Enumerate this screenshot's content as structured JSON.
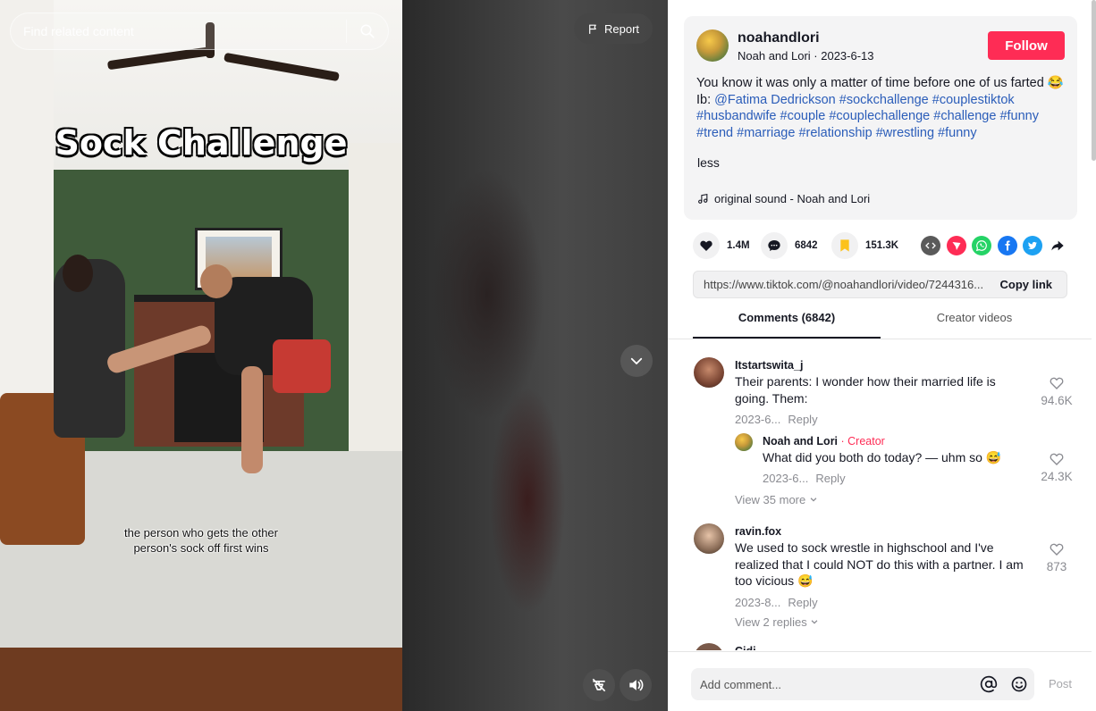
{
  "search": {
    "placeholder": "Find related content"
  },
  "video": {
    "overlay_title": "Sock Challenge",
    "overlay_caption": "the person who gets the other person's sock off first wins",
    "report_label": "Report"
  },
  "post": {
    "username": "noahandlori",
    "display_name": "Noah and Lori",
    "date": "2023-6-13",
    "follow_label": "Follow",
    "desc_intro": "You know it was only a matter of time before one of us farted 😂 Ib: ",
    "tags": [
      "@Fatima Dedrickson",
      "#sockchallenge",
      "#couplestiktok",
      "#husbandwife",
      "#couple",
      "#couplechallenge",
      "#challenge",
      "#funny",
      "#trend",
      "#marriage",
      "#relationship",
      "#wrestling",
      "#funny"
    ],
    "less_label": "less",
    "music": "original sound - Noah and Lori"
  },
  "stats": {
    "likes": "1.4M",
    "comments": "6842",
    "saves": "151.3K"
  },
  "share_icons": [
    "embed-icon",
    "send-icon",
    "whatsapp-icon",
    "facebook-icon",
    "twitter-icon",
    "share-arrow-icon"
  ],
  "link": {
    "url": "https://www.tiktok.com/@noahandlori/video/7244316...",
    "copy_label": "Copy link"
  },
  "tabs": {
    "comments": "Comments (6842)",
    "creator": "Creator videos"
  },
  "comments": [
    {
      "user": "Itstartswita_j",
      "text": "Their parents: I wonder how their married life is going. Them:",
      "date": "2023-6...",
      "reply_label": "Reply",
      "likes": "94.6K"
    },
    {
      "user": "Noah and Lori",
      "creator_tag": "· Creator",
      "text": "What did you both do today? — uhm so 😅",
      "date": "2023-6...",
      "reply_label": "Reply",
      "likes": "24.3K"
    },
    {
      "user": "ravin.fox",
      "text": "We used to sock wrestle in highschool and I've realized that I could NOT do this with a partner. I am too vicious 😅",
      "date": "2023-8...",
      "reply_label": "Reply",
      "likes": "873"
    },
    {
      "user": "Cidi..."
    }
  ],
  "view_more": [
    "View 35 more",
    "View 2 replies"
  ],
  "composer": {
    "placeholder": "Add comment...",
    "post_label": "Post"
  },
  "colors": {
    "accent": "#fe2c55",
    "hashtag": "#2b5db9",
    "save": "#fcc21b"
  }
}
